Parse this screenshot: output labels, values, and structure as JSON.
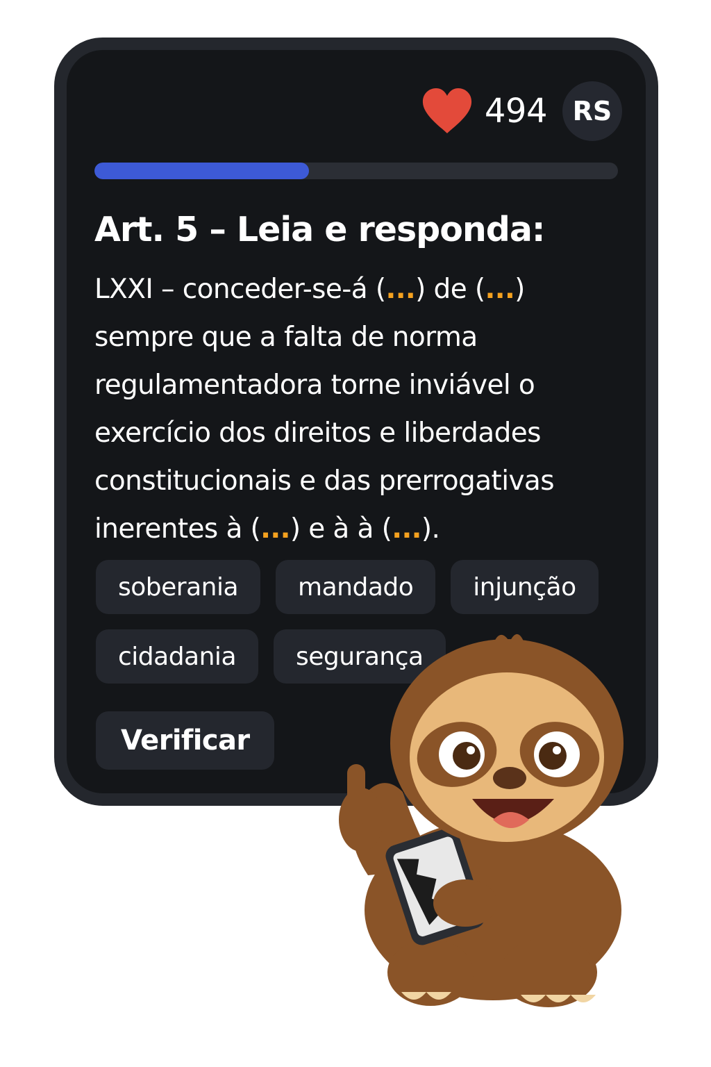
{
  "header": {
    "lives_icon": "heart-icon",
    "lives_count": "494",
    "avatar_initials": "RS"
  },
  "progress": {
    "fraction": 0.41
  },
  "question": {
    "title": "Art. 5 – Leia e responda:",
    "lines": [
      [
        {
          "t": "LXXI – conceder-se-á ("
        },
        {
          "t": "...",
          "blank": true
        },
        {
          "t": ") de ("
        },
        {
          "t": "...",
          "blank": true
        },
        {
          "t": ")"
        }
      ],
      [
        {
          "t": "sempre que a falta de norma"
        }
      ],
      [
        {
          "t": "regulamentadora torne inviável o"
        }
      ],
      [
        {
          "t": "exercício dos direitos e liberdades"
        }
      ],
      [
        {
          "t": "constitucionais e das prerrogativas"
        }
      ],
      [
        {
          "t": "inerentes à ("
        },
        {
          "t": "...",
          "blank": true
        },
        {
          "t": ") e  à à ("
        },
        {
          "t": "...",
          "blank": true
        },
        {
          "t": ")."
        }
      ]
    ]
  },
  "options": [
    [
      "soberania",
      "mandado",
      "injunção"
    ],
    [
      "cidadania",
      "segurança"
    ]
  ],
  "actions": {
    "verify_label": "Verificar"
  },
  "mascot": {
    "icon": "sloth-mascot-holding-phone"
  },
  "colors": {
    "background": "#141619",
    "frame": "#24272d",
    "progress": "#3d5ad6",
    "blank": "#f4a11f",
    "heart": "#e34a3a"
  }
}
